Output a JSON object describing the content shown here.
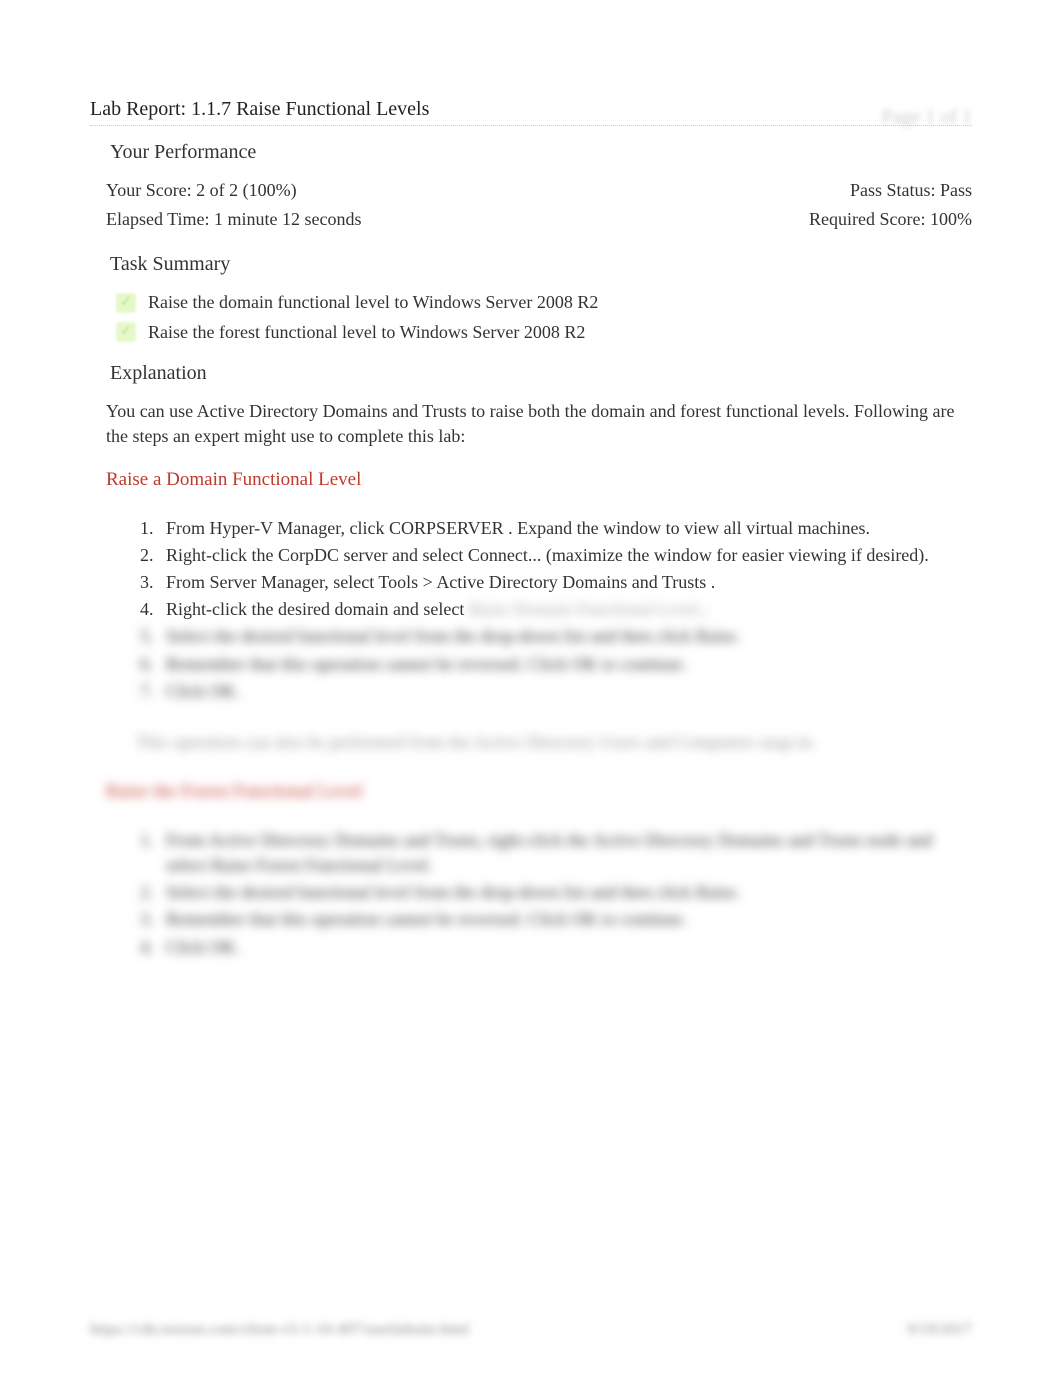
{
  "page_label": "Page 1 of 1",
  "report_title": "Lab Report: 1.1.7 Raise Functional Levels",
  "performance": {
    "heading": "Your Performance",
    "score": "Your Score: 2 of 2 (100%)",
    "pass_status": "Pass Status: Pass",
    "elapsed": "Elapsed Time: 1 minute 12 seconds",
    "required": "Required Score: 100%"
  },
  "task_summary": {
    "heading": "Task Summary",
    "items": [
      "Raise the domain functional level to Windows Server 2008 R2",
      "Raise the forest functional level to Windows Server 2008 R2"
    ]
  },
  "explanation": {
    "heading": "Explanation",
    "intro": "You can use Active Directory Domains and Trusts to raise both the domain and forest functional levels. Following are the steps an expert might use to complete this lab:",
    "section1_heading": "Raise a Domain Functional Level",
    "steps1": {
      "s1a": "From Hyper-V Manager, click ",
      "s1b": "CORPSERVER",
      "s1c": " . Expand the window to view all virtual machines.",
      "s2a": "Right-click the CorpDC  server and select ",
      "s2b": "Connect...",
      "s2c": "  (maximize the window for easier viewing if desired).",
      "s3a": "From Server Manager, select ",
      "s3b": "Tools",
      "s3c": "  > ",
      "s3d": "Active Directory Domains and Trusts",
      "s3e": "    .",
      "s4a": "Right-click the desired domain and select ",
      "s4_blur": "Raise Domain Functional Level...",
      "s5_blur": "Select the desired functional level from the drop-down list and then click Raise.",
      "s6_blur": "Remember that this operation cannot be reversed. Click OK to continue.",
      "s7_blur": "Click OK."
    },
    "note_blur": "This operation can also be performed from the Active Directory Users and Computers snap-in.",
    "section2_heading_blur": "Raise the Forest Functional Level",
    "steps2_blur": {
      "s1": "From Active Directory Domains and Trusts, right-click the Active Directory Domains and Trusts node and select Raise Forest Functional Level.",
      "s2": "Select the desired functional level from the drop-down list and then click Raise.",
      "s3": "Remember that this operation cannot be reversed. Click OK to continue.",
      "s4": "Click OK."
    }
  },
  "footer_left": "https://cdn.testout.com/client-v5-1-10-497/startlabsim.html",
  "footer_right": "9/19/2017"
}
